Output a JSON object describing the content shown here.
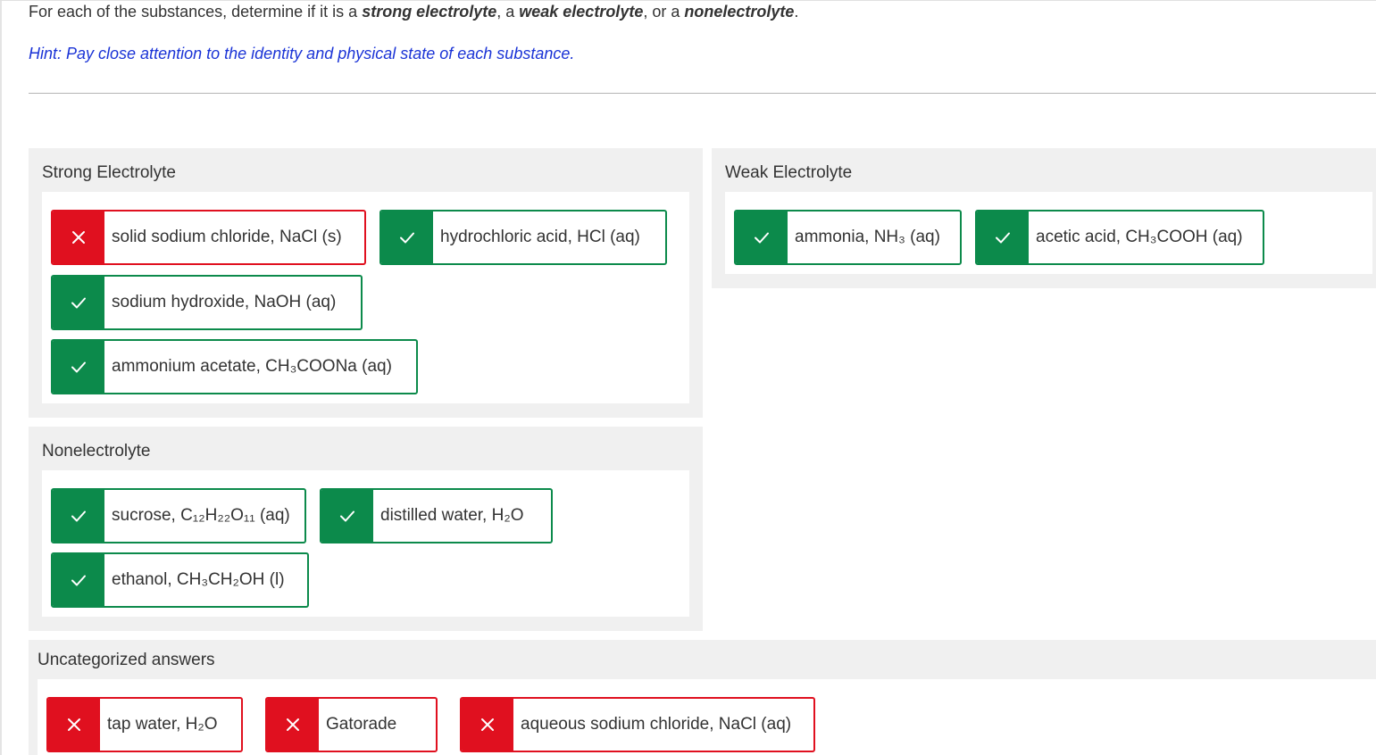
{
  "question": {
    "prefix": "For each of the substances, determine if it is a ",
    "term_strong": "strong electrolyte",
    "sep_1": ", a ",
    "term_weak": "weak electrolyte",
    "sep_2": ", or a ",
    "term_non": "nonelectrolyte",
    "suffix": "."
  },
  "hint": "Hint: Pay close attention to the identity and physical state of each substance.",
  "colors": {
    "correct": "#0c8a4b",
    "incorrect": "#e0101f",
    "hint": "#1a33d6",
    "bucket_bg": "#f0f0f0"
  },
  "buckets": {
    "strong": {
      "title": "Strong Electrolyte",
      "items": [
        {
          "label": "solid sodium chloride, NaCl (s)",
          "status": "incorrect",
          "icon": "x-icon"
        },
        {
          "label": "hydrochloric acid, HCl (aq)",
          "status": "correct",
          "icon": "check-icon"
        },
        {
          "label": "sodium hydroxide, NaOH (aq)",
          "status": "correct",
          "icon": "check-icon"
        },
        {
          "label": "ammonium acetate, CH₃COONa (aq)",
          "status": "correct",
          "icon": "check-icon"
        }
      ]
    },
    "weak": {
      "title": "Weak Electrolyte",
      "items": [
        {
          "label": "ammonia, NH₃ (aq)",
          "status": "correct",
          "icon": "check-icon"
        },
        {
          "label": "acetic acid, CH₃COOH (aq)",
          "status": "correct",
          "icon": "check-icon"
        }
      ]
    },
    "non": {
      "title": "Nonelectrolyte",
      "items": [
        {
          "label": "sucrose, C₁₂H₂₂O₁₁ (aq)",
          "status": "correct",
          "icon": "check-icon"
        },
        {
          "label": "distilled water, H₂O",
          "status": "correct",
          "icon": "check-icon"
        },
        {
          "label": "ethanol, CH₃CH₂OH (l)",
          "status": "correct",
          "icon": "check-icon"
        }
      ]
    },
    "uncategorized": {
      "title": "Uncategorized answers",
      "items": [
        {
          "label": "tap water, H₂O",
          "status": "incorrect",
          "icon": "x-icon"
        },
        {
          "label": "Gatorade",
          "status": "incorrect",
          "icon": "x-icon"
        },
        {
          "label": "aqueous sodium chloride, NaCl (aq)",
          "status": "incorrect",
          "icon": "x-icon"
        }
      ]
    }
  }
}
